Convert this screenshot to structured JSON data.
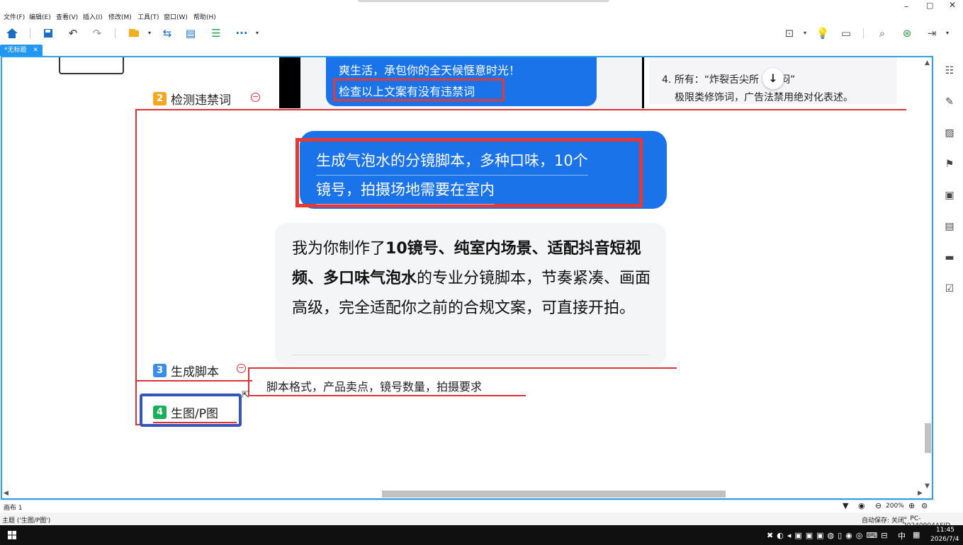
{
  "menu": [
    "文件(F)",
    "编辑(E)",
    "查看(V)",
    "插入(I)",
    "修改(M)",
    "工具(T)",
    "窗口(W)",
    "帮助(H)"
  ],
  "tab": {
    "label": "*无标题",
    "close": "✕"
  },
  "chat_top": {
    "line1": "爽生活，承包你的全天候惬意时光！",
    "line2": "检查以上文案有没有违禁词",
    "note": "4. 所有：“炸裂舌尖所",
    "note_tail": "闷”",
    "note2": "极限类修饰词，广告法禁用绝对化表述。"
  },
  "topics": [
    {
      "num": "2",
      "label": "检测违禁词",
      "color": "#f5a623"
    },
    {
      "num": "3",
      "label": "生成脚本",
      "color": "#3b8ee8"
    },
    {
      "num": "4",
      "label": "生图/P图",
      "color": "#1ab05a"
    }
  ],
  "user_bubble": {
    "line1": "生成气泡水的分镜脚本，多种口味，10个",
    "line2": "镜号，拍摄场地需要在室内"
  },
  "ai_reply": {
    "part1": "我为你制作了",
    "bold1": "10镜号、纯室内场景、适配抖音短视频、多口味气泡水",
    "part2": "的专业分镜脚本，节奏紧凑、画面高级，完全适配你之前的合规文案，可直接开拍。"
  },
  "subtopic": "脚本格式，产品卖点，镜号数量，拍摄要求",
  "sheet": {
    "name": "画布 1",
    "zoom": "200%"
  },
  "status": {
    "left": "主题 ('生图/P图')",
    "autosave": "自动保存: 关闭",
    "pc": "PC-20240904ASJD"
  },
  "taskbar": {
    "time": "11:45",
    "date": "2026/7/4",
    "ime": "中"
  },
  "colors": {
    "accent": "#2196f3",
    "bubble": "#1a73e8",
    "highlight_red": "#e53935",
    "select_blue": "#3556b8"
  }
}
